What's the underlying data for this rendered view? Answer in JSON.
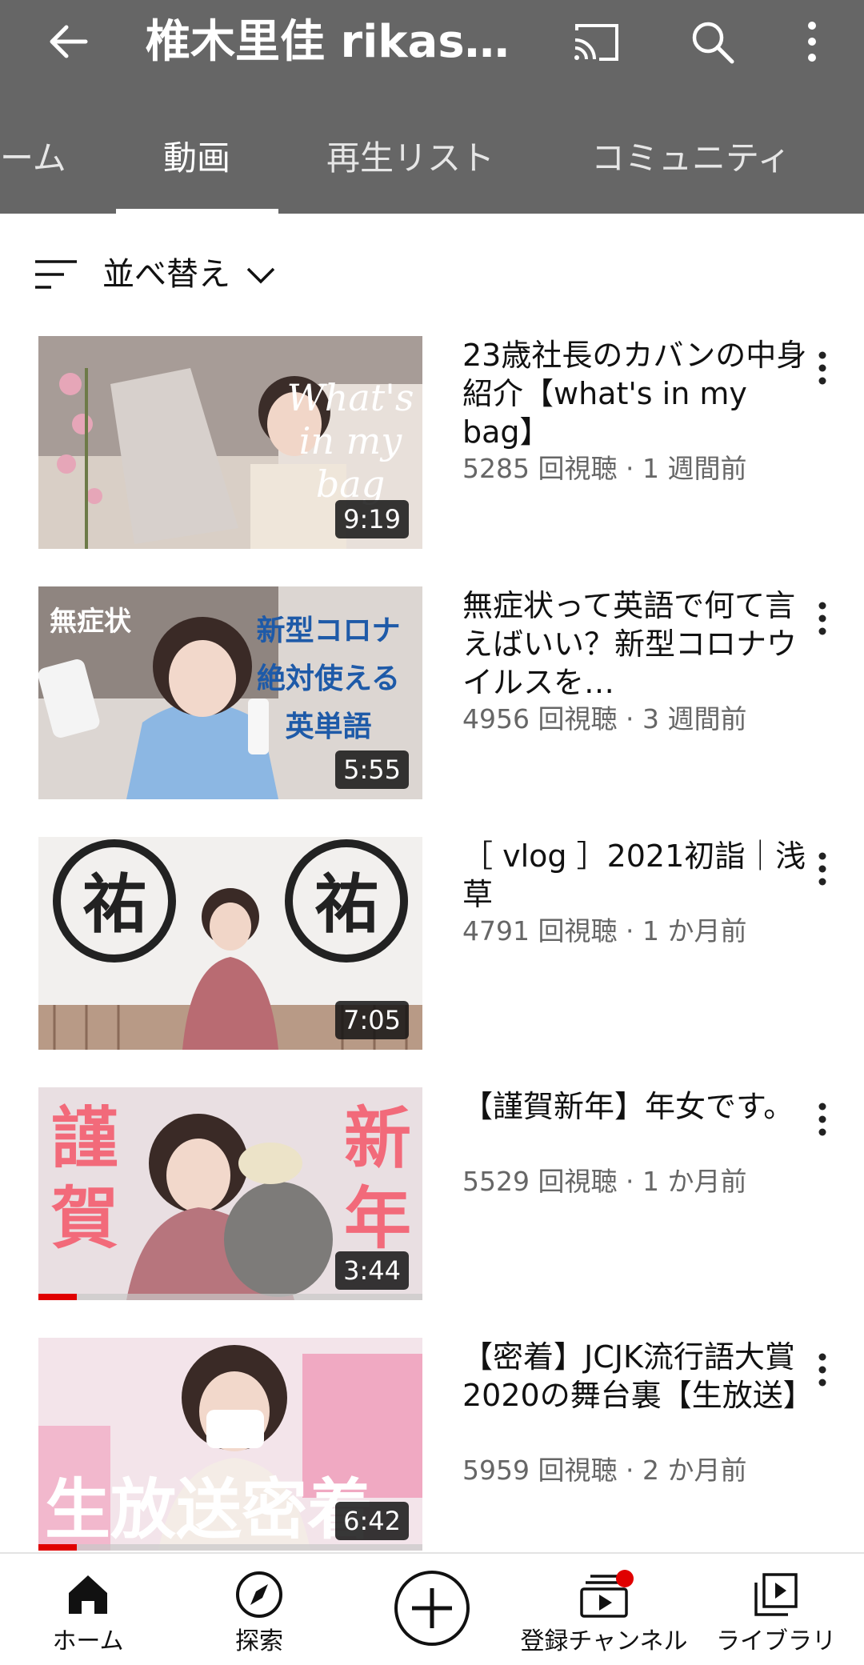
{
  "header": {
    "channel_title": "椎木里佳 rikashi…",
    "icons": [
      "back-arrow-icon",
      "cast-icon",
      "search-icon",
      "more-vert-icon"
    ]
  },
  "tabs": [
    {
      "label": "ーム",
      "active": false
    },
    {
      "label": "動画",
      "active": true
    },
    {
      "label": "再生リスト",
      "active": false
    },
    {
      "label": "コミュニティ",
      "active": false
    }
  ],
  "sort": {
    "label": "並べ替え"
  },
  "videos": [
    {
      "title": "23歳社長のカバンの中身紹介【what's in my bag】",
      "views": "5285 回視聴",
      "age": "1 週間前",
      "duration": "9:19",
      "progress": 0
    },
    {
      "title": "無症状って英語で何て言えばいい？新型コロナウイルスを…",
      "views": "4956 回視聴",
      "age": "3 週間前",
      "duration": "5:55",
      "progress": 0
    },
    {
      "title": "［ vlog ］2021初詣｜浅草",
      "views": "4791 回視聴",
      "age": "1 か月前",
      "duration": "7:05",
      "progress": 0
    },
    {
      "title": "【謹賀新年】年女です。",
      "views": "5529 回視聴",
      "age": "1 か月前",
      "duration": "3:44",
      "progress": 0.1
    },
    {
      "title": "【密着】JCJK流行語大賞2020の舞台裏【生放送】",
      "views": "5959 回視聴",
      "age": "2 か月前",
      "duration": "6:42",
      "progress": 0.1
    }
  ],
  "thumb_text": {
    "v1": "What's in my bag",
    "v2_a": "無症状",
    "v2_b": "新型コロナ",
    "v2_c": "絶対使える",
    "v2_d": "英単語",
    "v4_a": "謹賀",
    "v4_b": "新年",
    "v5": "生放送密着"
  },
  "bottom_nav": [
    {
      "label": "ホーム",
      "icon": "home-icon"
    },
    {
      "label": "探索",
      "icon": "explore-compass-icon"
    },
    {
      "label": "",
      "icon": "create-plus-icon"
    },
    {
      "label": "登録チャンネル",
      "icon": "subscriptions-icon"
    },
    {
      "label": "ライブラリ",
      "icon": "library-icon"
    }
  ],
  "colors": {
    "appbar": "#666666",
    "accent_red": "#e00000",
    "meta_text": "#666666"
  }
}
